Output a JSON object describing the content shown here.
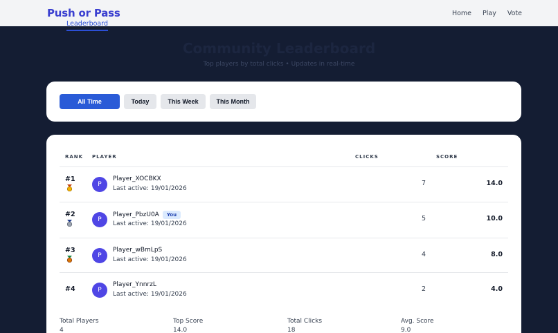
{
  "brand": "Push or Pass",
  "nav": {
    "home": "Home",
    "play": "Play",
    "vote": "Vote",
    "leaderboard": "Leaderboard"
  },
  "hero": {
    "title": "Community Leaderboard",
    "subtitle": "Top players by total clicks • Updates in real-time"
  },
  "filters": [
    "All Time",
    "Today",
    "This Week",
    "This Month"
  ],
  "table": {
    "headers": {
      "rank": "RANK",
      "player": "PLAYER",
      "clicks": "CLICKS",
      "score": "SCORE"
    },
    "rows": [
      {
        "rank": "#1",
        "medal": "gold-medal",
        "avatar": "P",
        "name": "Player_XOCBKX",
        "badge": "",
        "last_active": "Last active: 19/01/2026",
        "clicks": "7",
        "score": "14.0"
      },
      {
        "rank": "#2",
        "medal": "silver-medal",
        "avatar": "P",
        "name": "Player_PbzU0A",
        "badge": "You",
        "last_active": "Last active: 19/01/2026",
        "clicks": "5",
        "score": "10.0"
      },
      {
        "rank": "#3",
        "medal": "bronze-medal",
        "avatar": "P",
        "name": "Player_wBmLpS",
        "badge": "",
        "last_active": "Last active: 19/01/2026",
        "clicks": "4",
        "score": "8.0"
      },
      {
        "rank": "#4",
        "medal": "",
        "avatar": "P",
        "name": "Player_YnnrzL",
        "badge": "",
        "last_active": "Last active: 19/01/2026",
        "clicks": "2",
        "score": "4.0"
      }
    ]
  },
  "stats": {
    "total_players": {
      "label": "Total Players",
      "value": "4"
    },
    "top_score": {
      "label": "Top Score",
      "value": "14.0"
    },
    "total_clicks": {
      "label": "Total Clicks",
      "value": "18"
    },
    "avg_score": {
      "label": "Avg. Score",
      "value": "9.0"
    }
  },
  "colors": {
    "accent": "#2a5bd7",
    "brand": "#3a3fd0",
    "avatar": "#4f46e5",
    "background": "#141d33"
  }
}
